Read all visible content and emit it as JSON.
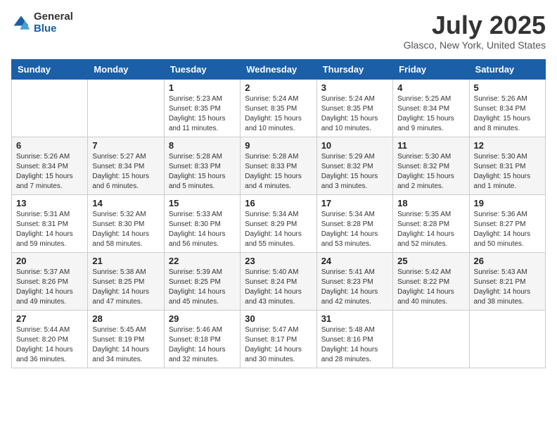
{
  "header": {
    "logo_general": "General",
    "logo_blue": "Blue",
    "title": "July 2025",
    "location": "Glasco, New York, United States"
  },
  "days_of_week": [
    "Sunday",
    "Monday",
    "Tuesday",
    "Wednesday",
    "Thursday",
    "Friday",
    "Saturday"
  ],
  "weeks": [
    [
      {
        "day": "",
        "info": ""
      },
      {
        "day": "",
        "info": ""
      },
      {
        "day": "1",
        "info": "Sunrise: 5:23 AM\nSunset: 8:35 PM\nDaylight: 15 hours and 11 minutes."
      },
      {
        "day": "2",
        "info": "Sunrise: 5:24 AM\nSunset: 8:35 PM\nDaylight: 15 hours and 10 minutes."
      },
      {
        "day": "3",
        "info": "Sunrise: 5:24 AM\nSunset: 8:35 PM\nDaylight: 15 hours and 10 minutes."
      },
      {
        "day": "4",
        "info": "Sunrise: 5:25 AM\nSunset: 8:34 PM\nDaylight: 15 hours and 9 minutes."
      },
      {
        "day": "5",
        "info": "Sunrise: 5:26 AM\nSunset: 8:34 PM\nDaylight: 15 hours and 8 minutes."
      }
    ],
    [
      {
        "day": "6",
        "info": "Sunrise: 5:26 AM\nSunset: 8:34 PM\nDaylight: 15 hours and 7 minutes."
      },
      {
        "day": "7",
        "info": "Sunrise: 5:27 AM\nSunset: 8:34 PM\nDaylight: 15 hours and 6 minutes."
      },
      {
        "day": "8",
        "info": "Sunrise: 5:28 AM\nSunset: 8:33 PM\nDaylight: 15 hours and 5 minutes."
      },
      {
        "day": "9",
        "info": "Sunrise: 5:28 AM\nSunset: 8:33 PM\nDaylight: 15 hours and 4 minutes."
      },
      {
        "day": "10",
        "info": "Sunrise: 5:29 AM\nSunset: 8:32 PM\nDaylight: 15 hours and 3 minutes."
      },
      {
        "day": "11",
        "info": "Sunrise: 5:30 AM\nSunset: 8:32 PM\nDaylight: 15 hours and 2 minutes."
      },
      {
        "day": "12",
        "info": "Sunrise: 5:30 AM\nSunset: 8:31 PM\nDaylight: 15 hours and 1 minute."
      }
    ],
    [
      {
        "day": "13",
        "info": "Sunrise: 5:31 AM\nSunset: 8:31 PM\nDaylight: 14 hours and 59 minutes."
      },
      {
        "day": "14",
        "info": "Sunrise: 5:32 AM\nSunset: 8:30 PM\nDaylight: 14 hours and 58 minutes."
      },
      {
        "day": "15",
        "info": "Sunrise: 5:33 AM\nSunset: 8:30 PM\nDaylight: 14 hours and 56 minutes."
      },
      {
        "day": "16",
        "info": "Sunrise: 5:34 AM\nSunset: 8:29 PM\nDaylight: 14 hours and 55 minutes."
      },
      {
        "day": "17",
        "info": "Sunrise: 5:34 AM\nSunset: 8:28 PM\nDaylight: 14 hours and 53 minutes."
      },
      {
        "day": "18",
        "info": "Sunrise: 5:35 AM\nSunset: 8:28 PM\nDaylight: 14 hours and 52 minutes."
      },
      {
        "day": "19",
        "info": "Sunrise: 5:36 AM\nSunset: 8:27 PM\nDaylight: 14 hours and 50 minutes."
      }
    ],
    [
      {
        "day": "20",
        "info": "Sunrise: 5:37 AM\nSunset: 8:26 PM\nDaylight: 14 hours and 49 minutes."
      },
      {
        "day": "21",
        "info": "Sunrise: 5:38 AM\nSunset: 8:25 PM\nDaylight: 14 hours and 47 minutes."
      },
      {
        "day": "22",
        "info": "Sunrise: 5:39 AM\nSunset: 8:25 PM\nDaylight: 14 hours and 45 minutes."
      },
      {
        "day": "23",
        "info": "Sunrise: 5:40 AM\nSunset: 8:24 PM\nDaylight: 14 hours and 43 minutes."
      },
      {
        "day": "24",
        "info": "Sunrise: 5:41 AM\nSunset: 8:23 PM\nDaylight: 14 hours and 42 minutes."
      },
      {
        "day": "25",
        "info": "Sunrise: 5:42 AM\nSunset: 8:22 PM\nDaylight: 14 hours and 40 minutes."
      },
      {
        "day": "26",
        "info": "Sunrise: 5:43 AM\nSunset: 8:21 PM\nDaylight: 14 hours and 38 minutes."
      }
    ],
    [
      {
        "day": "27",
        "info": "Sunrise: 5:44 AM\nSunset: 8:20 PM\nDaylight: 14 hours and 36 minutes."
      },
      {
        "day": "28",
        "info": "Sunrise: 5:45 AM\nSunset: 8:19 PM\nDaylight: 14 hours and 34 minutes."
      },
      {
        "day": "29",
        "info": "Sunrise: 5:46 AM\nSunset: 8:18 PM\nDaylight: 14 hours and 32 minutes."
      },
      {
        "day": "30",
        "info": "Sunrise: 5:47 AM\nSunset: 8:17 PM\nDaylight: 14 hours and 30 minutes."
      },
      {
        "day": "31",
        "info": "Sunrise: 5:48 AM\nSunset: 8:16 PM\nDaylight: 14 hours and 28 minutes."
      },
      {
        "day": "",
        "info": ""
      },
      {
        "day": "",
        "info": ""
      }
    ]
  ]
}
